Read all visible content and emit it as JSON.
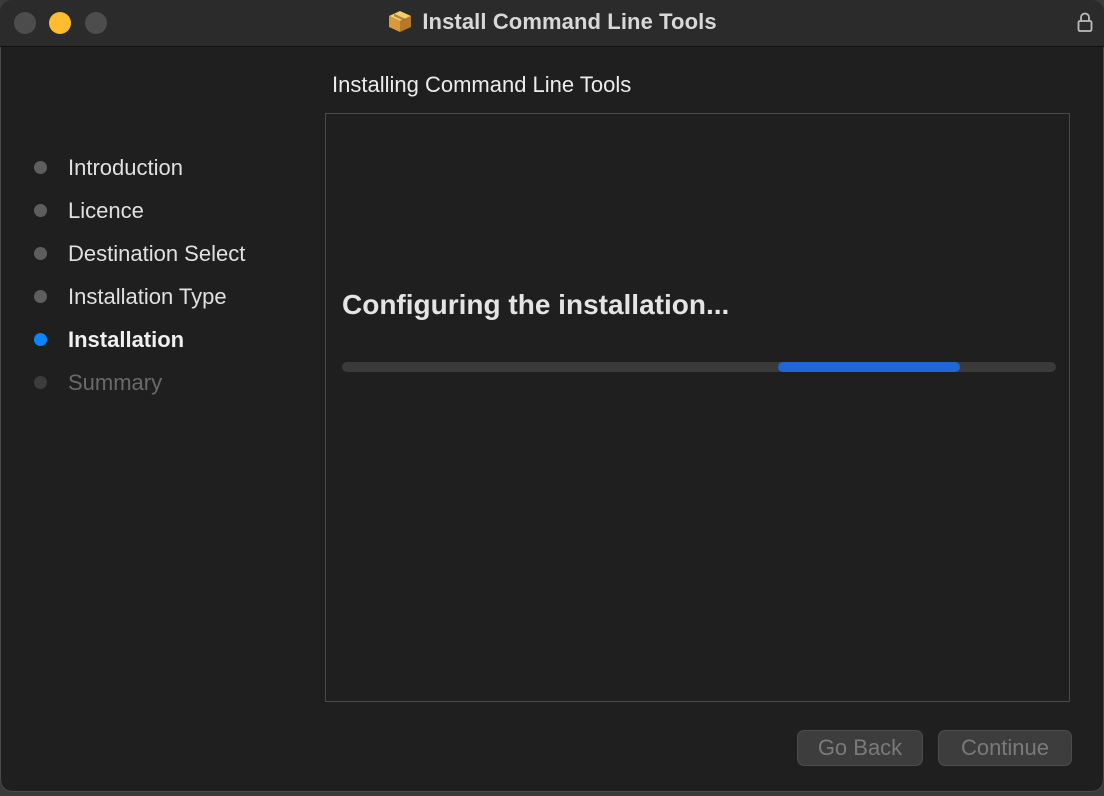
{
  "window": {
    "title": "Install Command Line Tools",
    "title_icon": "package-icon",
    "lock_icon": "lock-icon"
  },
  "traffic_lights": {
    "close_color": "#4d4d4d",
    "minimize_color": "#febc2e",
    "zoom_color": "#4d4d4d"
  },
  "panel": {
    "heading": "Installing Command Line Tools",
    "status": "Configuring the installation...",
    "progress": {
      "start": 0.61,
      "fill": 0.256,
      "indeterminate": true,
      "color": "#1f67d6"
    }
  },
  "sidebar": {
    "steps": [
      {
        "label": "Introduction",
        "state": "done"
      },
      {
        "label": "Licence",
        "state": "done"
      },
      {
        "label": "Destination Select",
        "state": "done"
      },
      {
        "label": "Installation Type",
        "state": "done"
      },
      {
        "label": "Installation",
        "state": "active"
      },
      {
        "label": "Summary",
        "state": "pending"
      }
    ],
    "active_color": "#0a84ff"
  },
  "buttons": {
    "go_back": "Go Back",
    "continue": "Continue"
  }
}
